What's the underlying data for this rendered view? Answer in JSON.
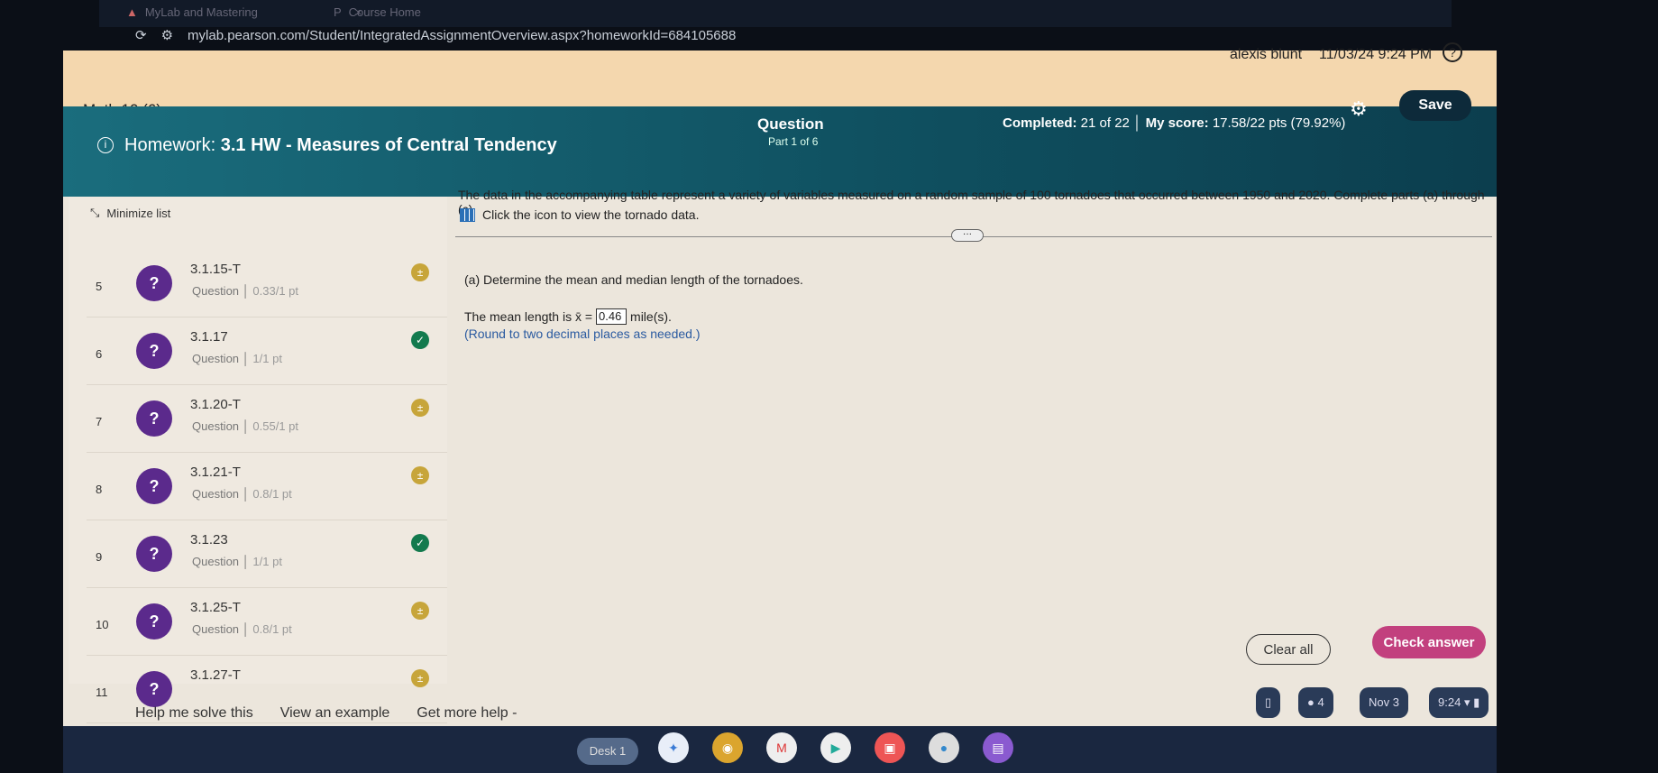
{
  "browser": {
    "tabs": [
      {
        "label": "MyLab and Mastering"
      },
      {
        "label": "Course Home"
      }
    ],
    "url": "mylab.pearson.com/Student/IntegratedAssignmentOverview.aspx?homeworkId=684105688"
  },
  "course": {
    "title": "Math 10 (6)",
    "user": "alexis blunt",
    "datetime": "11/03/24 9:24 PM"
  },
  "homework": {
    "prefix": "Homework:",
    "title": "3.1 HW - Measures of Central Tendency",
    "question_label": "Question",
    "part": "Part 1 of 6",
    "completed_label": "Completed:",
    "completed": "21 of 22",
    "score_label": "My score:",
    "score": "17.58/22 pts (79.92%)",
    "save": "Save"
  },
  "sidebar": {
    "minimize": "Minimize list",
    "items": [
      {
        "num": "5",
        "name": "3.1.15-T",
        "type": "Question",
        "points": "0.33/1 pt",
        "status": "partial"
      },
      {
        "num": "6",
        "name": "3.1.17",
        "type": "Question",
        "points": "1/1 pt",
        "status": "done"
      },
      {
        "num": "7",
        "name": "3.1.20-T",
        "type": "Question",
        "points": "0.55/1 pt",
        "status": "partial"
      },
      {
        "num": "8",
        "name": "3.1.21-T",
        "type": "Question",
        "points": "0.8/1 pt",
        "status": "partial"
      },
      {
        "num": "9",
        "name": "3.1.23",
        "type": "Question",
        "points": "1/1 pt",
        "status": "done"
      },
      {
        "num": "10",
        "name": "3.1.25-T",
        "type": "Question",
        "points": "0.8/1 pt",
        "status": "partial"
      },
      {
        "num": "11",
        "name": "3.1.27-T",
        "type": "",
        "points": "",
        "status": "partial"
      }
    ]
  },
  "question": {
    "intro": "The data in the accompanying table represent a variety of variables measured on a random sample of 100 tornadoes that occurred between 1950 and 2020. Complete parts (a) through (c).",
    "table_link": "Click the icon to view the tornado data.",
    "part_a": "(a) Determine the mean and median length of the tornadoes.",
    "mean_prefix": "The mean length is x̄ =",
    "mean_value": "0.46",
    "mean_unit": "mile(s).",
    "round_note": "(Round to two decimal places as needed.)"
  },
  "actions": {
    "clear": "Clear all",
    "check": "Check answer",
    "help": "Help me solve this",
    "example": "View an example",
    "more": "Get more help -"
  },
  "shelf": {
    "desk": "Desk 1",
    "notifications": "4",
    "date": "Nov 3",
    "time": "9:24"
  }
}
